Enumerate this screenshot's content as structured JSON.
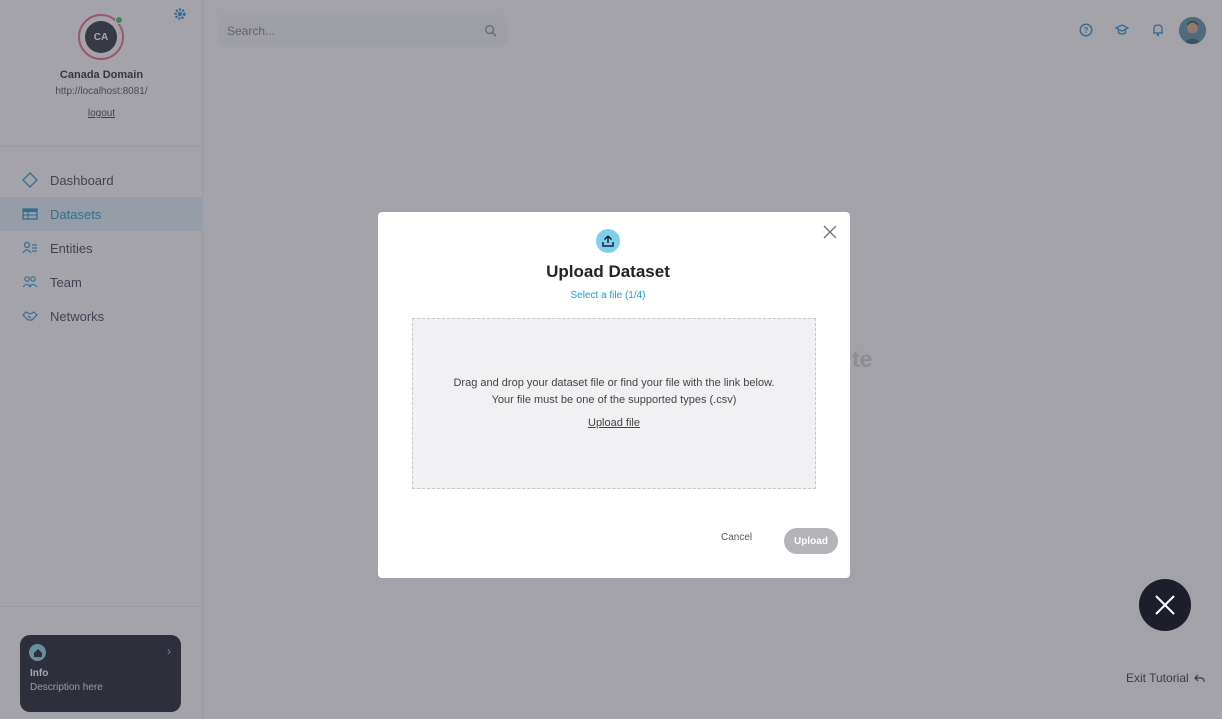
{
  "profile": {
    "initials": "CA",
    "name": "Canada Domain",
    "url": "http://localhost:8081/",
    "logout_label": "logout"
  },
  "nav": {
    "items": [
      {
        "label": "Dashboard",
        "icon": "diamond-icon"
      },
      {
        "label": "Datasets",
        "icon": "table-icon",
        "active": true
      },
      {
        "label": "Entities",
        "icon": "entities-icon"
      },
      {
        "label": "Team",
        "icon": "team-icon"
      },
      {
        "label": "Networks",
        "icon": "handshake-icon"
      }
    ]
  },
  "info_card": {
    "title": "Info",
    "description": "Description here"
  },
  "search": {
    "placeholder": "Search..."
  },
  "background": {
    "partial_text": "te"
  },
  "modal": {
    "title": "Upload Dataset",
    "step": "Select a file (1/4)",
    "dropzone_line1": "Drag and drop your dataset file or find your file with the link below.",
    "dropzone_line2": "Your file must be one of the supported types (.csv)",
    "upload_link": "Upload file",
    "cancel_label": "Cancel",
    "upload_label": "Upload"
  },
  "tutorial": {
    "exit_label": "Exit Tutorial"
  },
  "colors": {
    "accent": "#1b8bc8",
    "upload_icon_bg": "#7fd0f0",
    "online": "#2fbf4f"
  }
}
